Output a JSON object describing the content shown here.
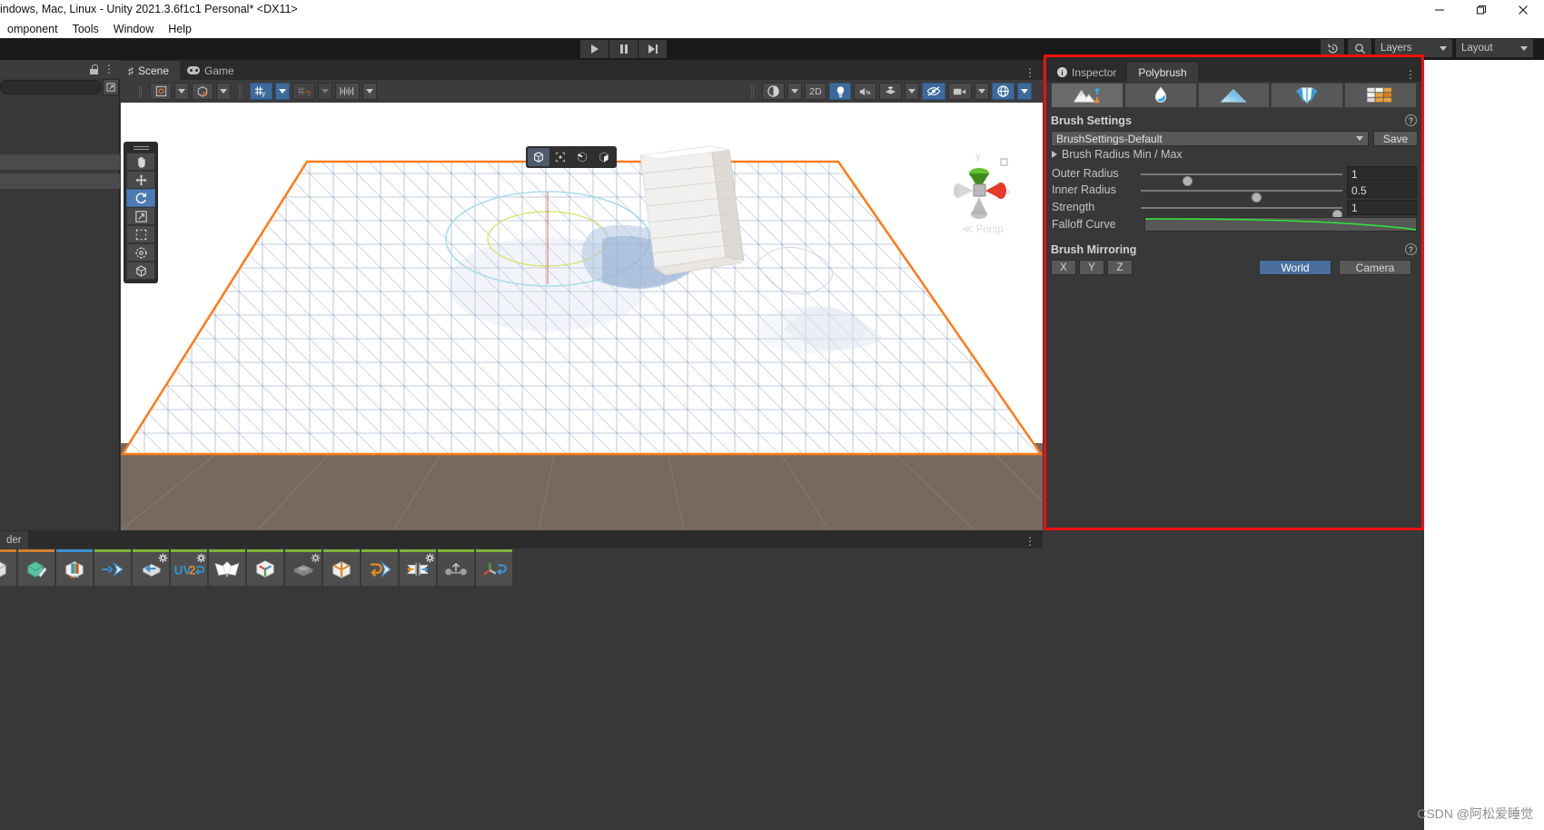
{
  "window": {
    "title": "indows, Mac, Linux - Unity 2021.3.6f1c1 Personal* <DX11>",
    "minimize": "—",
    "maximize": "❐",
    "close": "✕"
  },
  "menubar": {
    "items": [
      {
        "label": "omponent"
      },
      {
        "label": "Tools"
      },
      {
        "label": "Window"
      },
      {
        "label": "Help"
      }
    ]
  },
  "toolbar": {
    "play": "play-icon",
    "pause": "pause-icon",
    "step": "step-icon",
    "history_icon": "history-icon",
    "search_icon": "search-icon",
    "layers": "Layers",
    "layout": "Layout"
  },
  "left_panel": {
    "lock_icon": "lock-icon",
    "menu_icon": "kebab-menu-icon",
    "add_icon": "add-icon",
    "search_placeholder": ""
  },
  "scene": {
    "tabs": [
      {
        "label": "Scene",
        "icon": "grid-hash-icon",
        "active": true
      },
      {
        "label": "Game",
        "icon": "gamepad-icon",
        "active": false
      }
    ],
    "menu_icon": "kebab-menu-icon",
    "toolbar": {
      "pivot_icon": "pivot-center-icon",
      "handle_icon": "global-handle-icon",
      "grid_snap_icon": "grid-snapping-icon",
      "grid_snap_active": true,
      "magnet_icon": "magnet-snapping-icon",
      "increment_icon": "increment-snapping-icon",
      "shading_icon": "shading-mode-icon",
      "twod_label": "2D",
      "light_icon": "lighting-icon",
      "light_active": true,
      "audio_icon": "audio-mute-icon",
      "fx_icon": "effects-icon",
      "hidden_icon": "scene-visibility-icon",
      "camera_icon": "camera-icon",
      "gizmos_icon": "gizmos-icon"
    },
    "tool_palette": [
      {
        "name": "hand-tool",
        "icon": "hand-icon",
        "selected": false
      },
      {
        "name": "move-tool",
        "icon": "move-icon",
        "selected": false
      },
      {
        "name": "rotate-tool",
        "icon": "rotate-icon",
        "selected": true
      },
      {
        "name": "scale-tool",
        "icon": "scale-icon",
        "selected": false
      },
      {
        "name": "rect-tool",
        "icon": "rect-transform-icon",
        "selected": false
      },
      {
        "name": "transform-tool",
        "icon": "transform-icon",
        "selected": false
      },
      {
        "name": "custom-tool",
        "icon": "custom-editor-tool-icon",
        "selected": false
      }
    ],
    "element_modes": [
      {
        "name": "object-mode",
        "icon": "cube-object-icon",
        "selected": true
      },
      {
        "name": "vertex-mode",
        "icon": "vertex-icon",
        "selected": false
      },
      {
        "name": "edge-mode",
        "icon": "edge-icon",
        "selected": false
      },
      {
        "name": "face-mode",
        "icon": "face-icon",
        "selected": false
      }
    ],
    "gizmo": {
      "axis_y": "y",
      "axis_x": "x",
      "perspective_label": "Persp",
      "perspective_arrow": "≪"
    }
  },
  "project_panel": {
    "tab_label": "der",
    "menu_icon": "kebab-menu-icon",
    "probuilder_tools": [
      {
        "name": "new-shape",
        "icon": "new-shape-icon",
        "accent": "orange",
        "gear": false
      },
      {
        "name": "new-poly-shape",
        "icon": "poly-shape-icon",
        "accent": "orange",
        "gear": false
      },
      {
        "name": "material-editor",
        "icon": "material-editor-icon",
        "accent": "blue",
        "gear": false
      },
      {
        "name": "select-holes",
        "icon": "select-holes-icon",
        "accent": "green",
        "gear": false
      },
      {
        "name": "extrude-faces",
        "icon": "extrude-faces-icon",
        "accent": "green",
        "gear": true
      },
      {
        "name": "uv2-generate",
        "icon": "uv2-icon",
        "accent": "green",
        "gear": true
      },
      {
        "name": "flip-normals",
        "icon": "flip-normals-icon",
        "accent": "green",
        "gear": false
      },
      {
        "name": "center-pivot",
        "icon": "center-pivot-icon",
        "accent": "green",
        "gear": false
      },
      {
        "name": "subdivide-object",
        "icon": "subdivide-object-icon",
        "accent": "none",
        "gear": true
      },
      {
        "name": "conform-normals",
        "icon": "conform-normals-icon",
        "accent": "green",
        "gear": false
      },
      {
        "name": "merge-objects",
        "icon": "merge-objects-icon",
        "accent": "green",
        "gear": false
      },
      {
        "name": "mirror-objects",
        "icon": "mirror-objects-icon",
        "accent": "green",
        "gear": true
      },
      {
        "name": "subdivide-edges",
        "icon": "subdivide-edges-icon",
        "accent": "none",
        "gear": false
      },
      {
        "name": "set-pivot",
        "icon": "set-pivot-icon",
        "accent": "green",
        "gear": false
      }
    ]
  },
  "inspector": {
    "tabs": [
      {
        "label": "Inspector",
        "icon": "info-icon",
        "active": false
      },
      {
        "label": "Polybrush",
        "icon": "",
        "active": true
      }
    ],
    "menu_icon": "kebab-menu-icon",
    "modes": [
      {
        "name": "sculpt-mode",
        "icon": "sculpt-terrain-icon",
        "selected": true
      },
      {
        "name": "smooth-mode",
        "icon": "water-drop-icon",
        "selected": false
      },
      {
        "name": "paint-mode",
        "icon": "blue-triangle-icon",
        "selected": false
      },
      {
        "name": "color-mode",
        "icon": "gem-paint-icon",
        "selected": false
      },
      {
        "name": "texture-mode",
        "icon": "texture-blend-icon",
        "selected": false
      }
    ],
    "brush_settings": {
      "title": "Brush Settings",
      "help_icon": "help-icon",
      "preset": "BrushSettings-Default",
      "preset_caret": "dropdown-caret-icon",
      "save_label": "Save",
      "foldout_label": "Brush Radius Min / Max",
      "foldout_arrow": "collapsed-arrow-icon",
      "sliders": [
        {
          "label": "Outer Radius",
          "value": "1",
          "knob_pct": 23
        },
        {
          "label": "Inner Radius",
          "value": "0.5",
          "knob_pct": 57
        },
        {
          "label": "Strength",
          "value": "1",
          "knob_pct": 100
        }
      ],
      "curve_label": "Falloff Curve",
      "curve_color": "#2de83a"
    },
    "brush_mirroring": {
      "title": "Brush Mirroring",
      "help_icon": "help-icon",
      "axes": [
        {
          "label": "X",
          "on": false
        },
        {
          "label": "Y",
          "on": false
        },
        {
          "label": "Z",
          "on": false
        }
      ],
      "space": [
        {
          "label": "World",
          "on": true
        },
        {
          "label": "Camera",
          "on": false
        }
      ]
    }
  },
  "watermark": {
    "text": "CSDN @阿松爱睡觉"
  },
  "colors": {
    "accent_red": "#f01010",
    "selection_orange": "#ff7a18",
    "unity_blue": "#4a6f9e",
    "curve_green": "#2de83a",
    "panel_bg": "#383838",
    "panel_dark": "#2b2b2b"
  }
}
